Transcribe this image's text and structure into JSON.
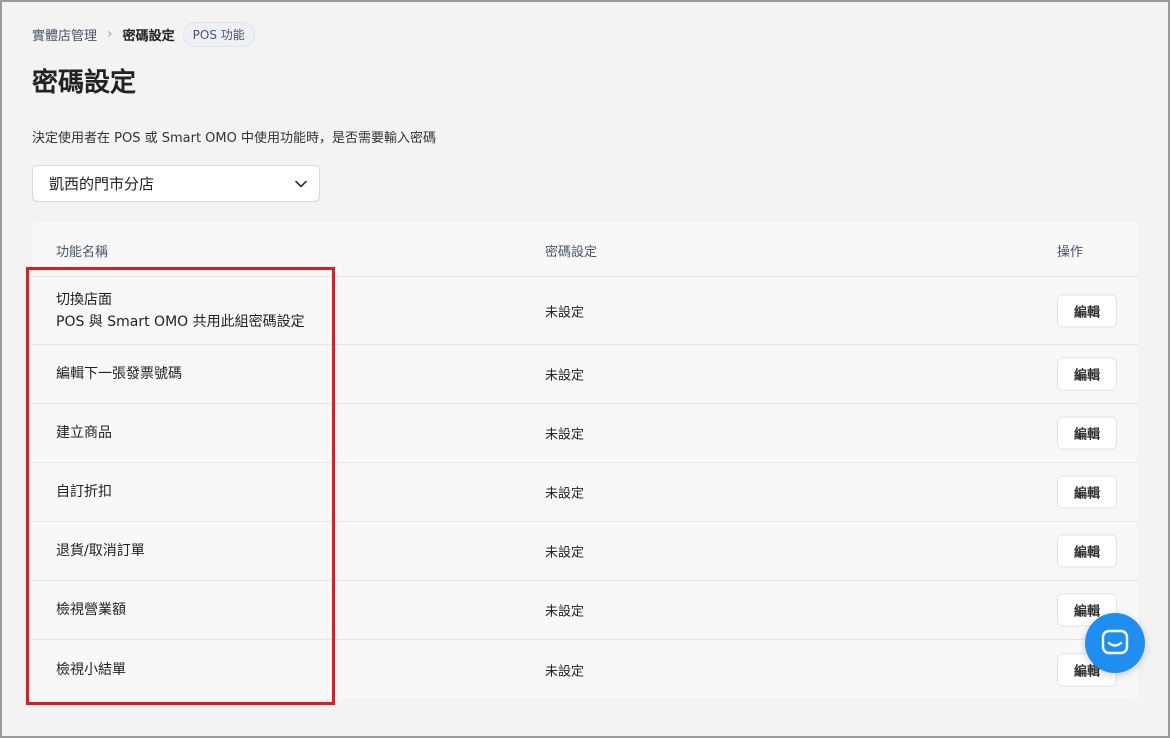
{
  "breadcrumb": {
    "parent": "實體店管理",
    "separator": "›",
    "current": "密碼設定",
    "badge": "POS 功能"
  },
  "page": {
    "title": "密碼設定",
    "description": "決定使用者在 POS 或 Smart OMO 中使用功能時，是否需要輸入密碼"
  },
  "store_select": {
    "value": "凱西的門市分店"
  },
  "table": {
    "headers": {
      "name": "功能名稱",
      "password": "密碼設定",
      "action": "操作"
    },
    "rows": [
      {
        "name": "切換店面",
        "subtitle": "POS 與 Smart OMO 共用此組密碼設定",
        "password": "未設定",
        "action": "編輯"
      },
      {
        "name": "編輯下一張發票號碼",
        "password": "未設定",
        "action": "編輯"
      },
      {
        "name": "建立商品",
        "password": "未設定",
        "action": "編輯"
      },
      {
        "name": "自訂折扣",
        "password": "未設定",
        "action": "編輯"
      },
      {
        "name": "退貨/取消訂單",
        "password": "未設定",
        "action": "編輯"
      },
      {
        "name": "檢視營業額",
        "password": "未設定",
        "action": "編輯"
      },
      {
        "name": "檢視小結單",
        "password": "未設定",
        "action": "編輯"
      }
    ]
  },
  "colors": {
    "highlight": "#e31b1b",
    "chat_button": "#1f8ef1"
  },
  "icons": {
    "select_caret": "chevron-down-icon",
    "chat": "chat-icon"
  }
}
